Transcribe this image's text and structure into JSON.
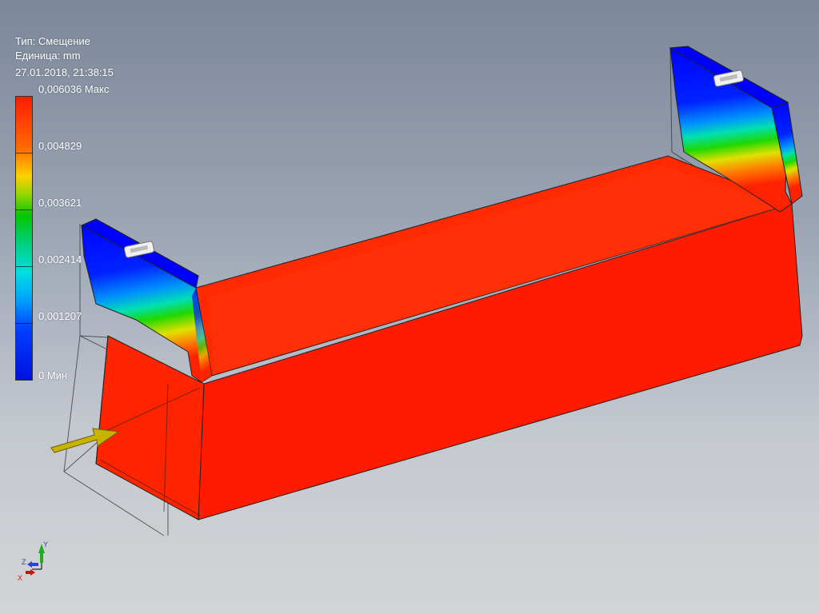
{
  "legend": {
    "type_line": "Тип: Смещение",
    "unit_line": "Единица: mm",
    "timestamp": "27.01.2018, 21:38:15",
    "scale_labels": [
      "0,006036 Макс",
      "0,004829",
      "0,003621",
      "0,002414",
      "0,001207",
      "0 Мин"
    ]
  },
  "triad": {
    "y_label": "Y",
    "z_label": "Z",
    "x_label": "X"
  },
  "colors": {
    "max": "#ff2200",
    "min": "#0000ff",
    "load_arrow": "#c8b400"
  },
  "icons": {
    "load": "load-arrow-icon",
    "constraint": "fixed-constraint-icon"
  }
}
